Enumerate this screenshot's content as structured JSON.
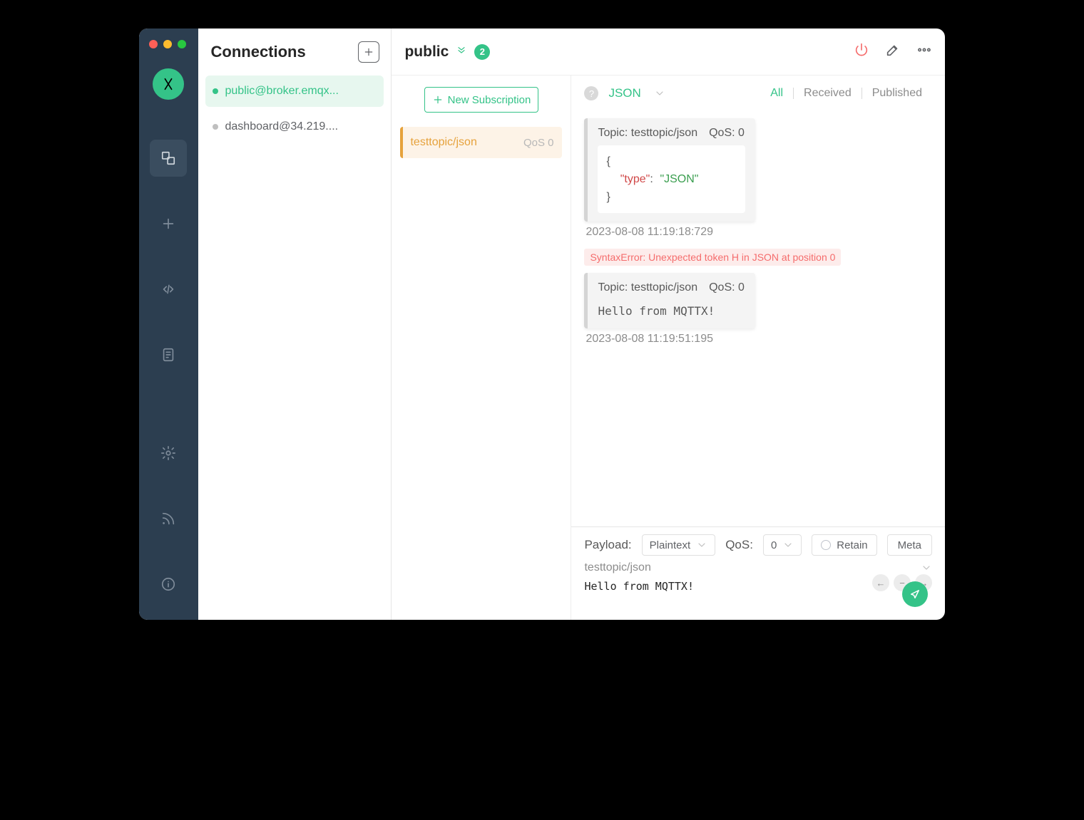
{
  "sidebar_title": "Connections",
  "connections": [
    {
      "label": "public@broker.emqx...",
      "active": true
    },
    {
      "label": "dashboard@34.219....",
      "active": false
    }
  ],
  "header": {
    "name": "public",
    "badge": "2"
  },
  "subscriptions": {
    "new_button": "New Subscription",
    "items": [
      {
        "topic": "testtopic/json",
        "qos": "QoS 0"
      }
    ]
  },
  "messages": {
    "format": "JSON",
    "tabs": {
      "all": "All",
      "received": "Received",
      "published": "Published"
    },
    "list": [
      {
        "topic_label": "Topic:",
        "topic": "testtopic/json",
        "qos_label": "QoS:",
        "qos": "0",
        "body_json": {
          "key": "\"type\"",
          "val": "\"JSON\""
        },
        "timestamp": "2023-08-08 11:19:18:729"
      },
      {
        "error": "SyntaxError: Unexpected token H in JSON at position 0",
        "topic_label": "Topic:",
        "topic": "testtopic/json",
        "qos_label": "QoS:",
        "qos": "0",
        "body_plain": "Hello from MQTTX!",
        "timestamp": "2023-08-08 11:19:51:195"
      }
    ]
  },
  "composer": {
    "payload_label": "Payload:",
    "payload_format": "Plaintext",
    "qos_label": "QoS:",
    "qos_value": "0",
    "retain": "Retain",
    "meta": "Meta",
    "topic": "testtopic/json",
    "text": "Hello from MQTTX!"
  }
}
